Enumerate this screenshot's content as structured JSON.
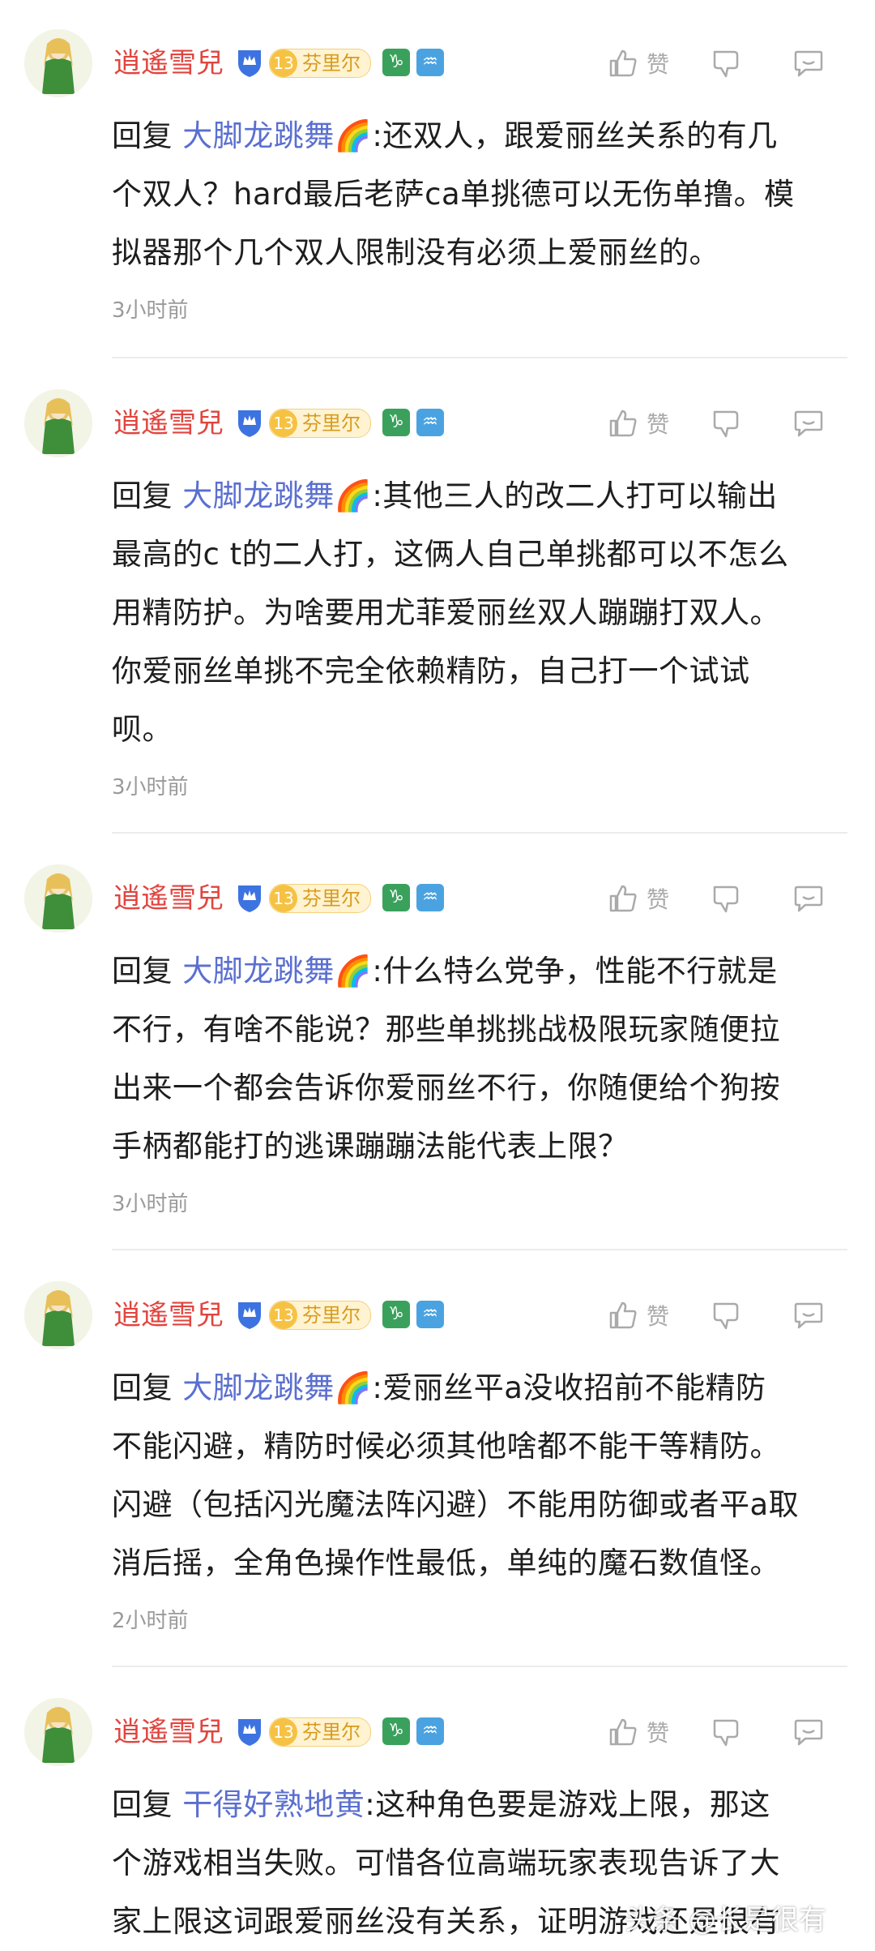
{
  "user": {
    "name": "逍遙雪兒",
    "level": "13",
    "title_badge": "芬里尔",
    "vip_icon": "crown-shield-icon",
    "zodiac_icon": "capricorn-icon",
    "aquarius_icon": "aquarius-icon"
  },
  "actions": {
    "like_label": "赞"
  },
  "colors": {
    "username": "#e0453f",
    "reply_link": "#5a6fd0",
    "level_gold": "#f6c244",
    "zodiac_green": "#3aa15c",
    "aquarius_blue": "#4aa3e0"
  },
  "comments": [
    {
      "reply_prefix": "回复 ",
      "reply_to": "大脚龙跳舞🌈",
      "text_lines": [
        ":还双人，跟爱丽丝关系的有几",
        "个双人？hard最后老萨ca单挑德可以无伤单撸。模",
        "拟器那个几个双人限制没有必须上爱丽丝的。"
      ],
      "time": "3小时前"
    },
    {
      "reply_prefix": "回复 ",
      "reply_to": "大脚龙跳舞🌈",
      "text_lines": [
        ":其他三人的改二人打可以输出",
        "最高的c t的二人打，这俩人自己单挑都可以不怎么",
        "用精防护。为啥要用尤菲爱丽丝双人蹦蹦打双人。",
        "你爱丽丝单挑不完全依赖精防，自己打一个试试",
        "呗。"
      ],
      "time": "3小时前"
    },
    {
      "reply_prefix": "回复 ",
      "reply_to": "大脚龙跳舞🌈",
      "text_lines": [
        ":什么特么党争，性能不行就是",
        "不行，有啥不能说？那些单挑挑战极限玩家随便拉",
        "出来一个都会告诉你爱丽丝不行，你随便给个狗按",
        "手柄都能打的逃课蹦蹦法能代表上限？"
      ],
      "time": "3小时前"
    },
    {
      "reply_prefix": "回复 ",
      "reply_to": "大脚龙跳舞🌈",
      "text_lines": [
        ":爱丽丝平a没收招前不能精防",
        "不能闪避，精防时候必须其他啥都不能干等精防。",
        "闪避（包括闪光魔法阵闪避）不能用防御或者平a取",
        "消后摇，全角色操作性最低，单纯的魔石数值怪。"
      ],
      "time": "2小时前"
    },
    {
      "reply_prefix": "回复 ",
      "reply_to": "干得好熟地黄",
      "text_lines": [
        ":这种角色要是游戏上限，那这",
        "个游戏相当失败。可惜各位高端玩家表现告诉了大",
        "家上限这词跟爱丽丝没有关系，证明游戏还是很有"
      ],
      "time": ""
    }
  ],
  "watermark": "头条 @长是很有"
}
